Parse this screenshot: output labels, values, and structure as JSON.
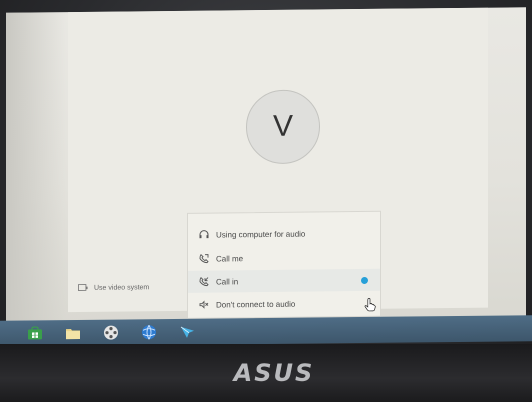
{
  "avatar": {
    "initial": "V"
  },
  "video_system": {
    "label": "Use video system",
    "icon": "video-system-icon"
  },
  "audio_menu": {
    "items": [
      {
        "label": "Using computer for audio",
        "icon": "headset-icon",
        "selected": false
      },
      {
        "label": "Call me",
        "icon": "phone-outgoing-icon",
        "selected": false
      },
      {
        "label": "Call in",
        "icon": "phone-incoming-icon",
        "selected": true
      },
      {
        "label": "Don't connect to audio",
        "icon": "speaker-mute-icon",
        "selected": false
      }
    ]
  },
  "taskbar": {
    "items": [
      {
        "name": "store-icon",
        "color": "#3aa04a"
      },
      {
        "name": "file-explorer-icon",
        "color": "#e9d48a"
      },
      {
        "name": "media-player-icon",
        "color": "#e6e6e6"
      },
      {
        "name": "browser-icon",
        "color": "#2d7bd1"
      },
      {
        "name": "webex-icon",
        "color": "#47b3e6"
      }
    ]
  },
  "brand": {
    "logo": "ASUS"
  },
  "colors": {
    "accent": "#27a0d8",
    "taskbar": "#4a6680"
  }
}
